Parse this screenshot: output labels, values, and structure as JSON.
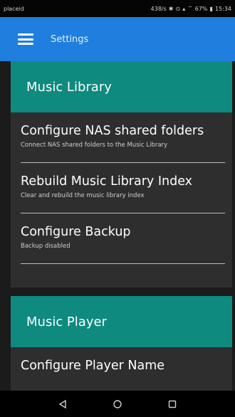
{
  "status": {
    "carrier": "placeid",
    "icons": [
      "network-speed-icon",
      "bluetooth-icon",
      "alarm-icon",
      "signal-icon",
      "wifi-icon",
      "battery-icon"
    ],
    "speed": "438/s",
    "battery": "67%",
    "time": "15:34"
  },
  "app_bar": {
    "menu_icon": "hamburger-icon",
    "title": "Settings",
    "color": "#1f7ede"
  },
  "sections": [
    {
      "header": "Music Library",
      "items": [
        {
          "title": "Configure NAS shared folders",
          "summary": "Connect NAS shared folders to the Music Library"
        },
        {
          "title": "Rebuild Music Library Index",
          "summary": "Clear and rebuild the music library index"
        },
        {
          "title": "Configure Backup",
          "summary": "Backup disabled"
        }
      ]
    },
    {
      "header": "Music Player",
      "items": [
        {
          "title": "Configure Player Name",
          "summary": ""
        }
      ]
    }
  ],
  "nav": {
    "back": "back-icon",
    "home": "home-icon",
    "recents": "recents-icon"
  },
  "colors": {
    "section_header": "#0e8a7f",
    "card": "#2e2e2e"
  }
}
